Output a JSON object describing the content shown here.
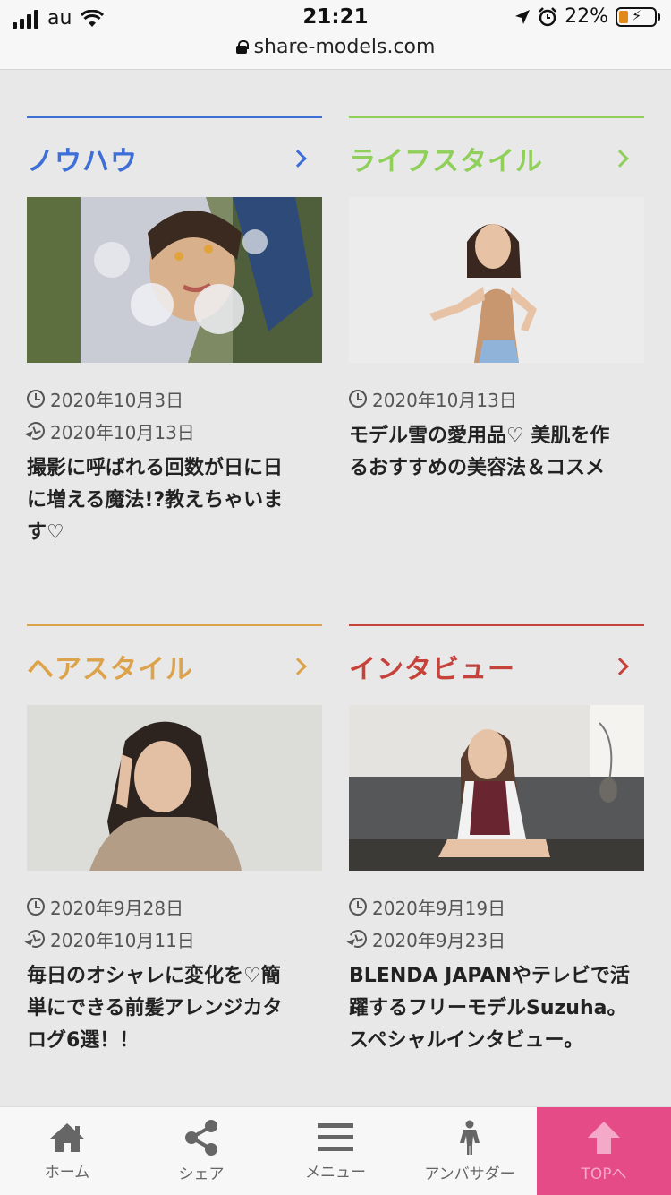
{
  "status_bar": {
    "carrier": "au",
    "time": "21:21",
    "battery": "22%",
    "url": "share-models.com"
  },
  "sections": [
    {
      "title": "ノウハウ",
      "color": "#3e6ed8",
      "created": "2020年10月3日",
      "updated": "2020年10月13日",
      "headline_lines": [
        "撮影に呼ばれる回数が日に日",
        "に増える魔法!?教えちゃいま",
        "す♡"
      ]
    },
    {
      "title": "ライフスタイル",
      "color": "#8fcf5a",
      "created": "2020年10月13日",
      "updated": "",
      "headline_lines": [
        "モデル雪の愛用品♡ 美肌を作",
        "るおすすめの美容法＆コスメ"
      ]
    },
    {
      "title": "ヘアスタイル",
      "color": "#dda34b",
      "created": "2020年9月28日",
      "updated": "2020年10月11日",
      "headline_lines": [
        "毎日のオシャレに変化を♡簡",
        "単にできる前髪アレンジカタ",
        "ログ6選！！"
      ]
    },
    {
      "title": "インタビュー",
      "color": "#c6433c",
      "created": "2020年9月19日",
      "updated": "2020年9月23日",
      "headline_lines": [
        "BLENDA JAPANやテレビで活",
        "躍するフリーモデルSuzuha。",
        "スペシャルインタビュー。"
      ]
    }
  ],
  "bottom_nav": [
    {
      "label": "ホーム",
      "icon": "home-icon"
    },
    {
      "label": "シェア",
      "icon": "share-icon"
    },
    {
      "label": "メニュー",
      "icon": "menu-icon"
    },
    {
      "label": "アンバサダー",
      "icon": "person-icon"
    },
    {
      "label": "TOPへ",
      "icon": "arrow-up-icon"
    }
  ]
}
